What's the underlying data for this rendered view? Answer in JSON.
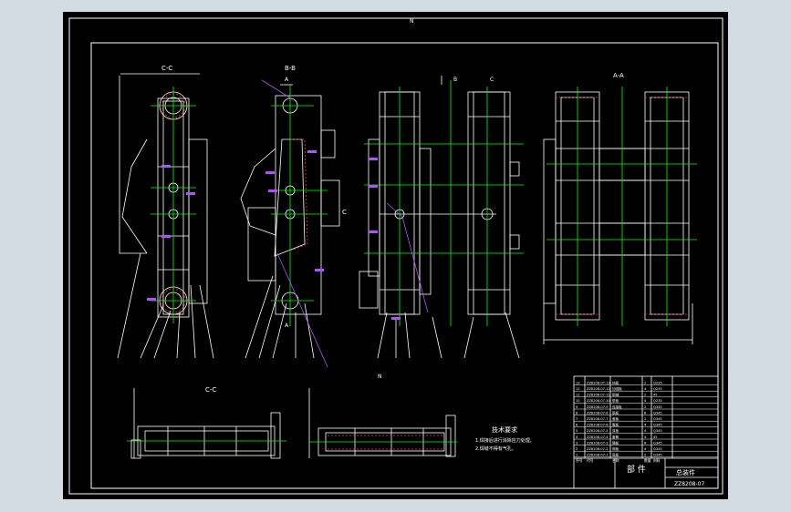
{
  "drawing": {
    "top_marker": "N",
    "views": {
      "left": "C-C",
      "middle": "B-B",
      "right": "A-A",
      "bottom_left": "C-C",
      "bottom_mid_mark": "N"
    },
    "section_marks": {
      "a": "A",
      "b": "B",
      "c": "C"
    },
    "notes": {
      "title": "技术要求",
      "line1": "1.焊接后进行消除应力处理。",
      "line2": "2.焊缝不得有气孔。"
    }
  },
  "title_block": {
    "part_name": "部 件",
    "assembly": "总装件",
    "drawing_no": "ZZ8208-07",
    "bom_rows": [
      {
        "no": "13",
        "code": "ZZ8208-07-13",
        "name": "挡板",
        "qty": "2",
        "mat": "Q235"
      },
      {
        "no": "12",
        "code": "ZZ8208-07-12",
        "name": "加强板",
        "qty": "4",
        "mat": "Q235"
      },
      {
        "no": "11",
        "code": "ZZ8208-07-11",
        "name": "销轴",
        "qty": "2",
        "mat": "45"
      },
      {
        "no": "10",
        "code": "ZZ8208-07-10",
        "name": "垫板",
        "qty": "4",
        "mat": "Q235"
      },
      {
        "no": "9",
        "code": "ZZ8208-07-9",
        "name": "连接板",
        "qty": "2",
        "mat": "Q345"
      },
      {
        "no": "8",
        "code": "ZZ8208-07-8",
        "name": "筋板",
        "qty": "8",
        "mat": "Q345"
      },
      {
        "no": "7",
        "code": "ZZ8208-07-7",
        "name": "盖板",
        "qty": "2",
        "mat": "Q345"
      },
      {
        "no": "6",
        "code": "ZZ8208-07-6",
        "name": "腹板",
        "qty": "4",
        "mat": "Q345"
      },
      {
        "no": "5",
        "code": "ZZ8208-07-5",
        "name": "耳板",
        "qty": "4",
        "mat": "Q345"
      },
      {
        "no": "4",
        "code": "ZZ8208-07-4",
        "name": "套筒",
        "qty": "4",
        "mat": "45"
      },
      {
        "no": "3",
        "code": "ZZ8208-07-3",
        "name": "隔板",
        "qty": "6",
        "mat": "Q345"
      },
      {
        "no": "2",
        "code": "ZZ8208-07-2",
        "name": "侧板",
        "qty": "4",
        "mat": "Q345"
      },
      {
        "no": "1",
        "code": "ZZ8208-07-1",
        "name": "底板",
        "qty": "2",
        "mat": "Q345"
      }
    ],
    "header": {
      "no": "序号",
      "code": "代号",
      "name": "名称",
      "qty": "数量",
      "mat": "材料"
    }
  }
}
